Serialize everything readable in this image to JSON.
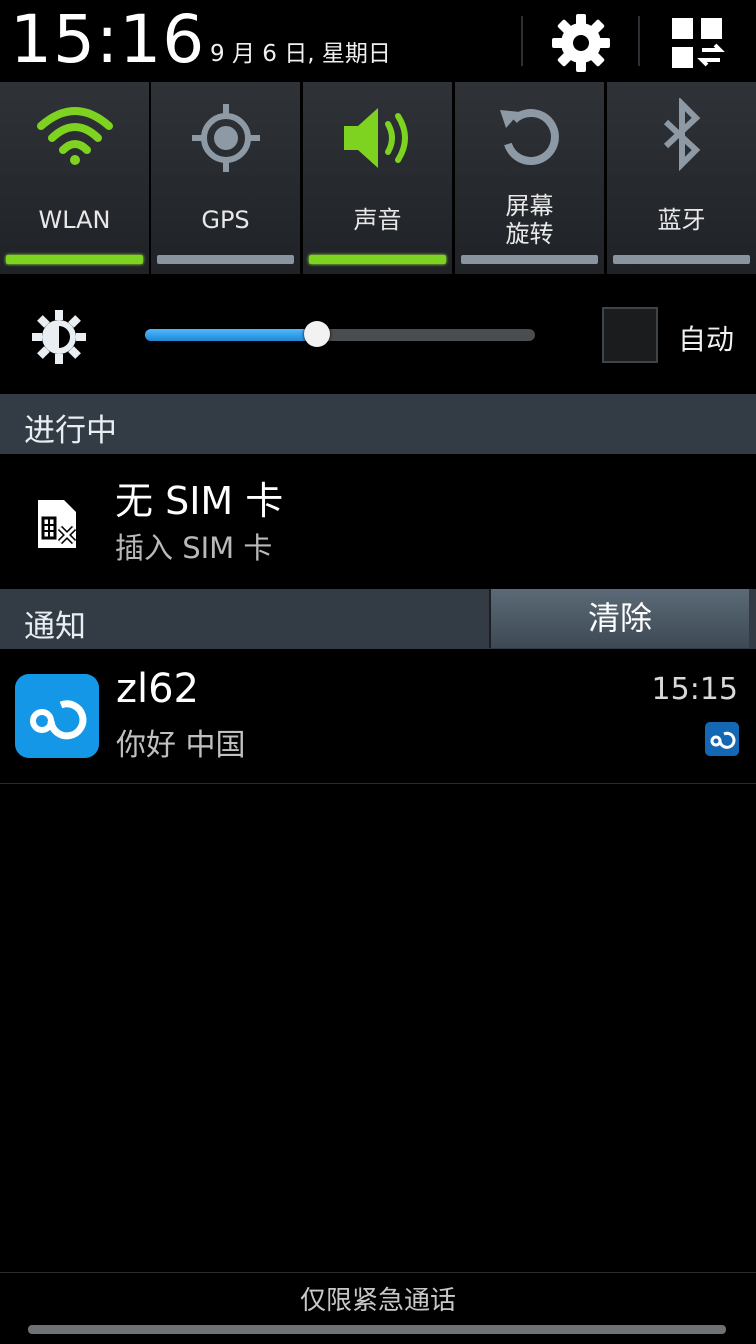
{
  "status": {
    "time": "15:16",
    "date": "9 月 6 日, 星期日"
  },
  "toggles": [
    {
      "label": "WLAN",
      "on": true,
      "icon": "wifi-icon"
    },
    {
      "label": "GPS",
      "on": false,
      "icon": "gps-icon"
    },
    {
      "label": "声音",
      "on": true,
      "icon": "speaker-icon"
    },
    {
      "label": "屏幕\n旋转",
      "line1": "屏幕",
      "line2": "旋转",
      "on": false,
      "icon": "rotate-icon"
    },
    {
      "label": "蓝牙",
      "on": false,
      "icon": "bluetooth-icon"
    }
  ],
  "brightness": {
    "level": 0.44,
    "auto_label": "自动",
    "auto_checked": false
  },
  "ongoing": {
    "header": "进行中",
    "title": "无 SIM 卡",
    "subtitle": "插入 SIM 卡"
  },
  "notifications": {
    "header": "通知",
    "clear_label": "清除",
    "items": [
      {
        "title": "zl62",
        "subtitle": "你好 中国",
        "time": "15:15"
      }
    ]
  },
  "footer": {
    "text": "仅限紧急通话"
  },
  "colors": {
    "toggle_on": "#7ed321",
    "toggle_off": "#8a949e",
    "accent": "#1e88d4"
  }
}
